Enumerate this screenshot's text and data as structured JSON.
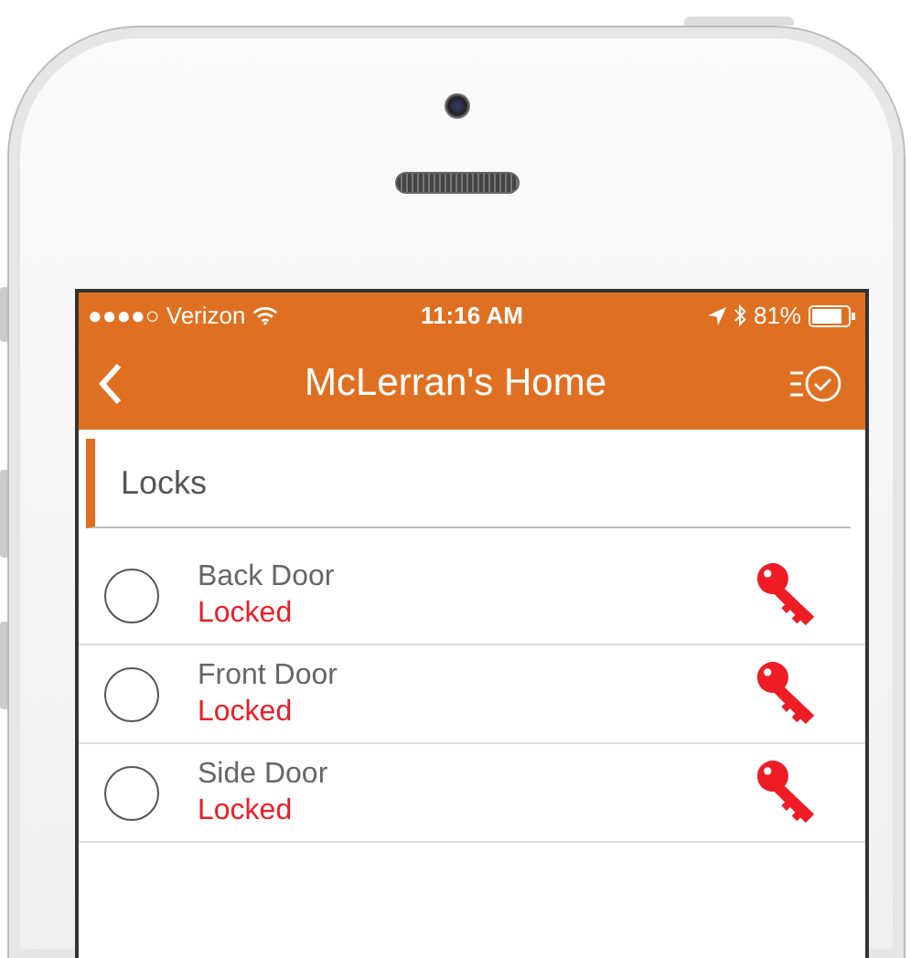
{
  "status_bar": {
    "carrier": "●●●●○ Verizon",
    "time": "11:16 AM",
    "battery": "81%"
  },
  "nav_bar": {
    "title": "McLerran's Home"
  },
  "section": {
    "title": "Locks"
  },
  "locks": [
    {
      "name": "Back Door",
      "status": "Locked",
      "locked": true,
      "selected": false
    },
    {
      "name": "Front Door",
      "status": "Locked",
      "locked": true,
      "selected": false
    },
    {
      "name": "Side Door",
      "status": "Locked",
      "locked": true,
      "selected": false
    }
  ]
}
